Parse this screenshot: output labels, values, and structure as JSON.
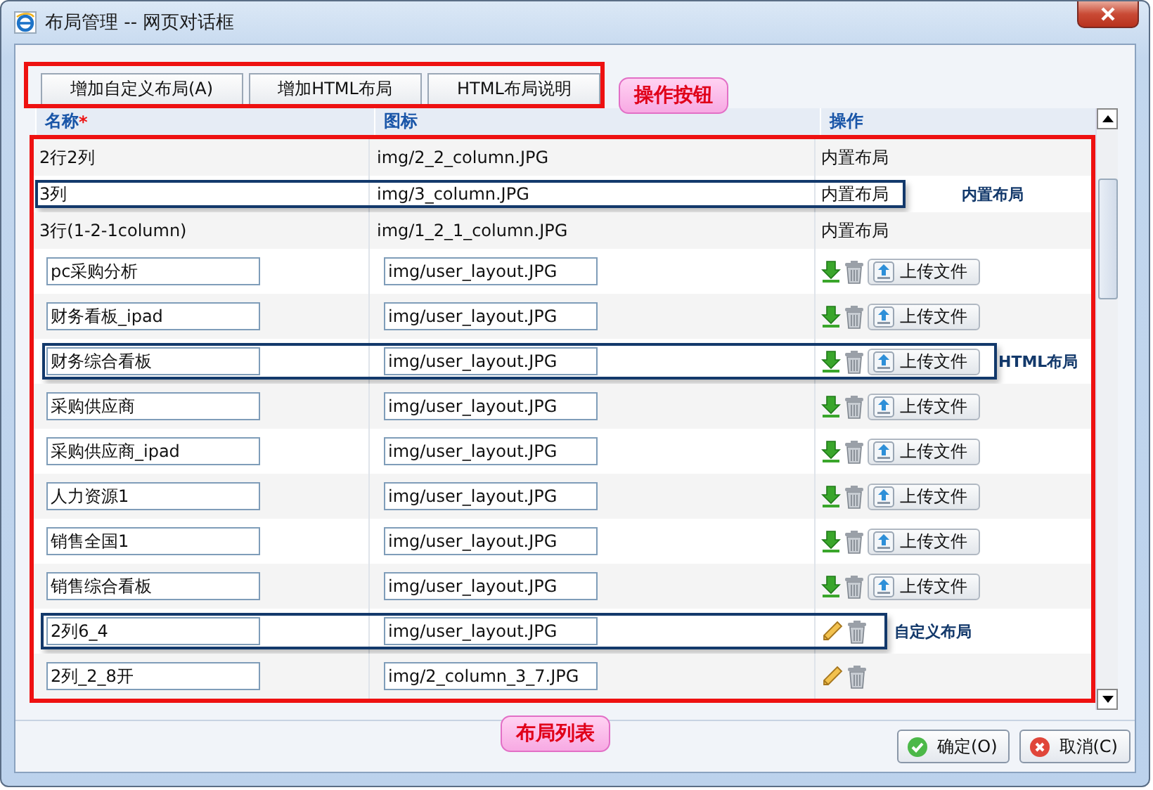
{
  "window": {
    "title": "布局管理 -- 网页对话框"
  },
  "toolbar_buttons": [
    "增加自定义布局(A)",
    "增加HTML布局",
    "HTML布局说明"
  ],
  "toolbar_callout": "操作按钮",
  "table": {
    "columns": [
      {
        "label": "名称",
        "mark": "*"
      },
      {
        "label": "图标"
      },
      {
        "label": "操作"
      }
    ],
    "rows": [
      {
        "kind": "builtin",
        "name": "2行2列",
        "icon": "img/2_2_column.JPG",
        "action": "内置布局"
      },
      {
        "kind": "builtin",
        "name": "3列",
        "icon": "img/3_column.JPG",
        "action": "内置布局",
        "note": "内置布局"
      },
      {
        "kind": "builtin",
        "name": "3行(1-2-1column)",
        "icon": "img/1_2_1_column.JPG",
        "action": "内置布局"
      },
      {
        "kind": "html",
        "name": "pc采购分析",
        "icon": "img/user_layout.JPG",
        "upload": "上传文件"
      },
      {
        "kind": "html",
        "name": "财务看板_ipad",
        "icon": "img/user_layout.JPG",
        "upload": "上传文件"
      },
      {
        "kind": "html",
        "name": "财务综合看板",
        "icon": "img/user_layout.JPG",
        "upload": "上传文件",
        "note": "HTML布局"
      },
      {
        "kind": "html",
        "name": "采购供应商",
        "icon": "img/user_layout.JPG",
        "upload": "上传文件"
      },
      {
        "kind": "html",
        "name": "采购供应商_ipad",
        "icon": "img/user_layout.JPG",
        "upload": "上传文件"
      },
      {
        "kind": "html",
        "name": "人力资源1",
        "icon": "img/user_layout.JPG",
        "upload": "上传文件"
      },
      {
        "kind": "html",
        "name": "销售全国1",
        "icon": "img/user_layout.JPG",
        "upload": "上传文件"
      },
      {
        "kind": "html",
        "name": "销售综合看板",
        "icon": "img/user_layout.JPG",
        "upload": "上传文件"
      },
      {
        "kind": "custom",
        "name": "2列6_4",
        "icon": "img/user_layout.JPG",
        "note": "自定义布局"
      },
      {
        "kind": "custom",
        "name": "2列_2_8开",
        "icon": "img/2_column_3_7.JPG"
      }
    ]
  },
  "list_callout": "布局列表",
  "footer_buttons": [
    {
      "kind": "ok",
      "label": "确定(O)"
    },
    {
      "kind": "cancel",
      "label": "取消(C)"
    }
  ]
}
